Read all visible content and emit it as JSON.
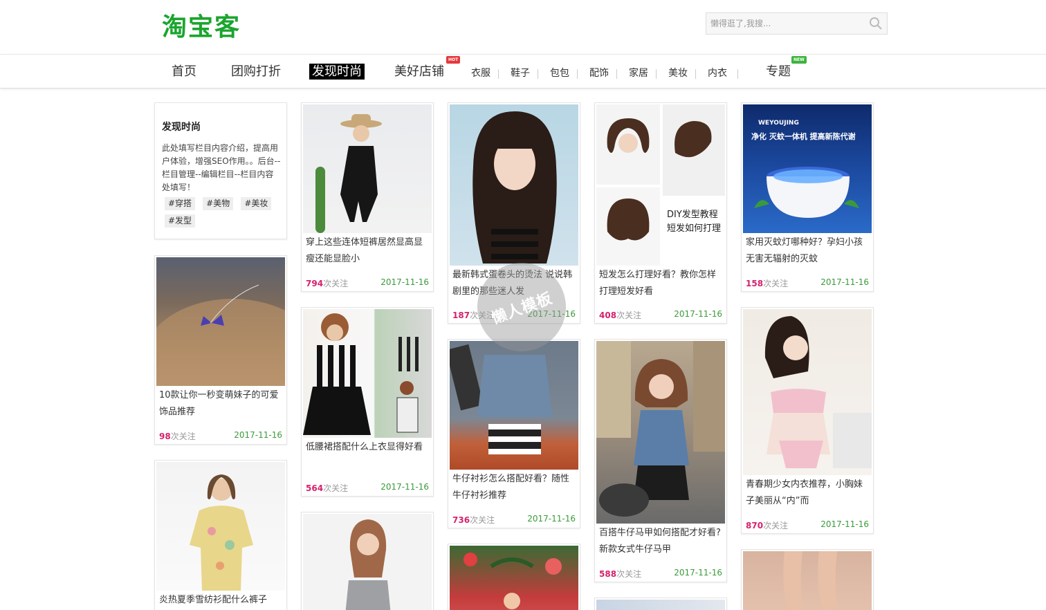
{
  "header": {
    "logo": "淘宝客",
    "search_placeholder": "懒得逛了,我搜..."
  },
  "nav": {
    "main": [
      {
        "label": "首页"
      },
      {
        "label": "团购打折"
      },
      {
        "label": "发现时尚"
      },
      {
        "label": "美好店铺",
        "badge": "HOT"
      },
      {
        "label": "专题",
        "badge": "NEW"
      }
    ],
    "sub": [
      "衣服",
      "鞋子",
      "包包",
      "配饰",
      "家居",
      "美妆",
      "内衣"
    ]
  },
  "intro": {
    "title": "发现时尚",
    "text": "此处填写栏目内容介绍，提高用户体验，增强SEO作用。。后台--栏目管理--编辑栏目--栏目内容处填写！",
    "tags": [
      "#穿搭",
      "#美物",
      "#美妆",
      "#发型"
    ]
  },
  "follow_label": "次关注",
  "cards": [
    {
      "title": "10款让你一秒变萌妹子的可爱饰品推荐",
      "count": "98",
      "date": "2017-11-16"
    },
    {
      "title": "炎热夏季雪纺衫配什么裤子",
      "count": "",
      "date": ""
    },
    {
      "title": "穿上这些连体短裤居然显高显瘦还能显脸小",
      "count": "794",
      "date": "2017-11-16"
    },
    {
      "title": "低腰裙搭配什么上衣显得好看",
      "count": "564",
      "date": "2017-11-16"
    },
    {
      "title": "",
      "count": "",
      "date": ""
    },
    {
      "title": "最新韩式蛋卷头的烫法 说说韩剧里的那些迷人发",
      "count": "187",
      "date": "2017-11-16"
    },
    {
      "title": "牛仔衬衫怎么搭配好看？随性牛仔衬衫推荐",
      "count": "736",
      "date": "2017-11-16"
    },
    {
      "title": "",
      "count": "",
      "date": ""
    },
    {
      "title": "短发怎么打理好看？教你怎样打理短发好看",
      "count": "408",
      "date": "2017-11-16",
      "overlay": [
        "DIY发型教程",
        "短发如何打理"
      ]
    },
    {
      "title": "百搭牛仔马甲如何搭配才好看?新款女式牛仔马甲",
      "count": "588",
      "date": "2017-11-16"
    },
    {
      "title": "",
      "count": "",
      "date": ""
    },
    {
      "title": "家用灭蚊灯哪种好？孕妇小孩无害无辐射的灭蚊",
      "count": "158",
      "date": "2017-11-16",
      "overlay": [
        "WEYOUJING",
        "净化 灭蚊一体机 提高新陈代谢"
      ]
    },
    {
      "title": "青春期少女内衣推荐，小胸妹子美丽从“内”而",
      "count": "870",
      "date": "2017-11-16"
    },
    {
      "title": "",
      "count": "",
      "date": ""
    }
  ],
  "watermark": "懒人模板",
  "colors": {
    "logo": "#1aa52e",
    "count": "#d6216c",
    "date": "#3a9a3a",
    "hot": "#e4393c",
    "new": "#3fb43f"
  }
}
